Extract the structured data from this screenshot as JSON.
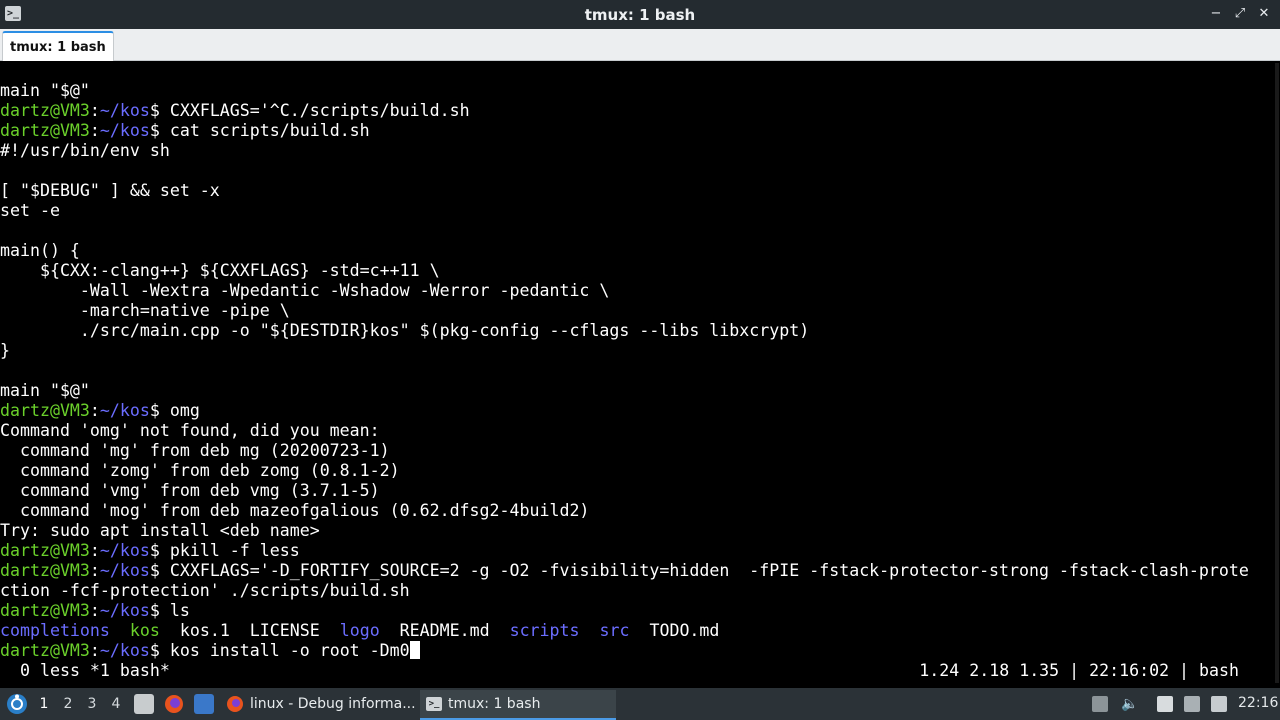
{
  "window": {
    "title": "tmux: 1 bash",
    "app_icon": "terminal-icon",
    "buttons": {
      "minimize": "−",
      "maximize": "⤢",
      "close": "✕"
    }
  },
  "tab": {
    "label": "tmux: 1 bash"
  },
  "terminal": {
    "prompt": {
      "user_host": "dartz@VM3",
      "path": "~/kos"
    },
    "lines": [
      {
        "type": "text",
        "text": "main \"$@\""
      },
      {
        "type": "prompt",
        "cmd": "CXXFLAGS='^C./scripts/build.sh"
      },
      {
        "type": "prompt",
        "cmd": "cat scripts/build.sh"
      },
      {
        "type": "text",
        "text": "#!/usr/bin/env sh"
      },
      {
        "type": "text",
        "text": ""
      },
      {
        "type": "text",
        "text": "[ \"$DEBUG\" ] && set -x"
      },
      {
        "type": "text",
        "text": "set -e"
      },
      {
        "type": "text",
        "text": ""
      },
      {
        "type": "text",
        "text": "main() {"
      },
      {
        "type": "text",
        "text": "    ${CXX:-clang++} ${CXXFLAGS} -std=c++11 \\"
      },
      {
        "type": "text",
        "text": "        -Wall -Wextra -Wpedantic -Wshadow -Werror -pedantic \\"
      },
      {
        "type": "text",
        "text": "        -march=native -pipe \\"
      },
      {
        "type": "text",
        "text": "        ./src/main.cpp -o \"${DESTDIR}kos\" $(pkg-config --cflags --libs libxcrypt)"
      },
      {
        "type": "text",
        "text": "}"
      },
      {
        "type": "text",
        "text": ""
      },
      {
        "type": "text",
        "text": "main \"$@\""
      },
      {
        "type": "prompt",
        "cmd": "omg"
      },
      {
        "type": "text",
        "text": "Command 'omg' not found, did you mean:"
      },
      {
        "type": "text",
        "text": "  command 'mg' from deb mg (20200723-1)"
      },
      {
        "type": "text",
        "text": "  command 'zomg' from deb zomg (0.8.1-2)"
      },
      {
        "type": "text",
        "text": "  command 'vmg' from deb vmg (3.7.1-5)"
      },
      {
        "type": "text",
        "text": "  command 'mog' from deb mazeofgalious (0.62.dfsg2-4build2)"
      },
      {
        "type": "text",
        "text": "Try: sudo apt install <deb name>"
      },
      {
        "type": "prompt",
        "cmd": "pkill -f less"
      },
      {
        "type": "prompt",
        "cmd": "CXXFLAGS='-D_FORTIFY_SOURCE=2 -g -O2 -fvisibility=hidden  -fPIE -fstack-protector-strong -fstack-clash-prote"
      },
      {
        "type": "text",
        "text": "ction -fcf-protection' ./scripts/build.sh"
      },
      {
        "type": "prompt",
        "cmd": "ls"
      },
      {
        "type": "ls",
        "entries": [
          {
            "name": "completions",
            "dir": true
          },
          {
            "name": "kos",
            "dir": false,
            "exec": true
          },
          {
            "name": "kos.1",
            "dir": false
          },
          {
            "name": "LICENSE",
            "dir": false
          },
          {
            "name": "logo",
            "dir": true
          },
          {
            "name": "README.md",
            "dir": false
          },
          {
            "name": "scripts",
            "dir": true
          },
          {
            "name": "src",
            "dir": true
          },
          {
            "name": "TODO.md",
            "dir": false
          }
        ]
      },
      {
        "type": "prompt",
        "cmd": "kos install -o root -Dm0",
        "cursor": true
      }
    ],
    "status_left": " 0 less *1 bash*",
    "status_right": "1.24 2.18 1.35 | 22:16:02 | bash"
  },
  "taskbar": {
    "start_icon": "distro-logo-icon",
    "workspaces": [
      "1",
      "2",
      "3",
      "4"
    ],
    "active_workspace": "1",
    "launchers": [
      "file-manager-icon",
      "firefox-icon",
      "show-desktop-icon"
    ],
    "tasks": [
      {
        "label": "linux - Debug informa...",
        "icon": "firefox-icon",
        "active": false
      },
      {
        "label": "tmux: 1 bash",
        "icon": "terminal-icon",
        "active": true
      }
    ],
    "tray": [
      "removable-drive-icon",
      "volume-icon",
      "clipboard-icon",
      "network-icon",
      "update-notifier-icon"
    ],
    "clock": "22:16"
  },
  "colors": {
    "prompt_user": "#6bd12b",
    "prompt_path": "#6b6dff",
    "directory": "#6b6dff",
    "exec": "#6bd12b",
    "accent": "#2c8ee4"
  }
}
